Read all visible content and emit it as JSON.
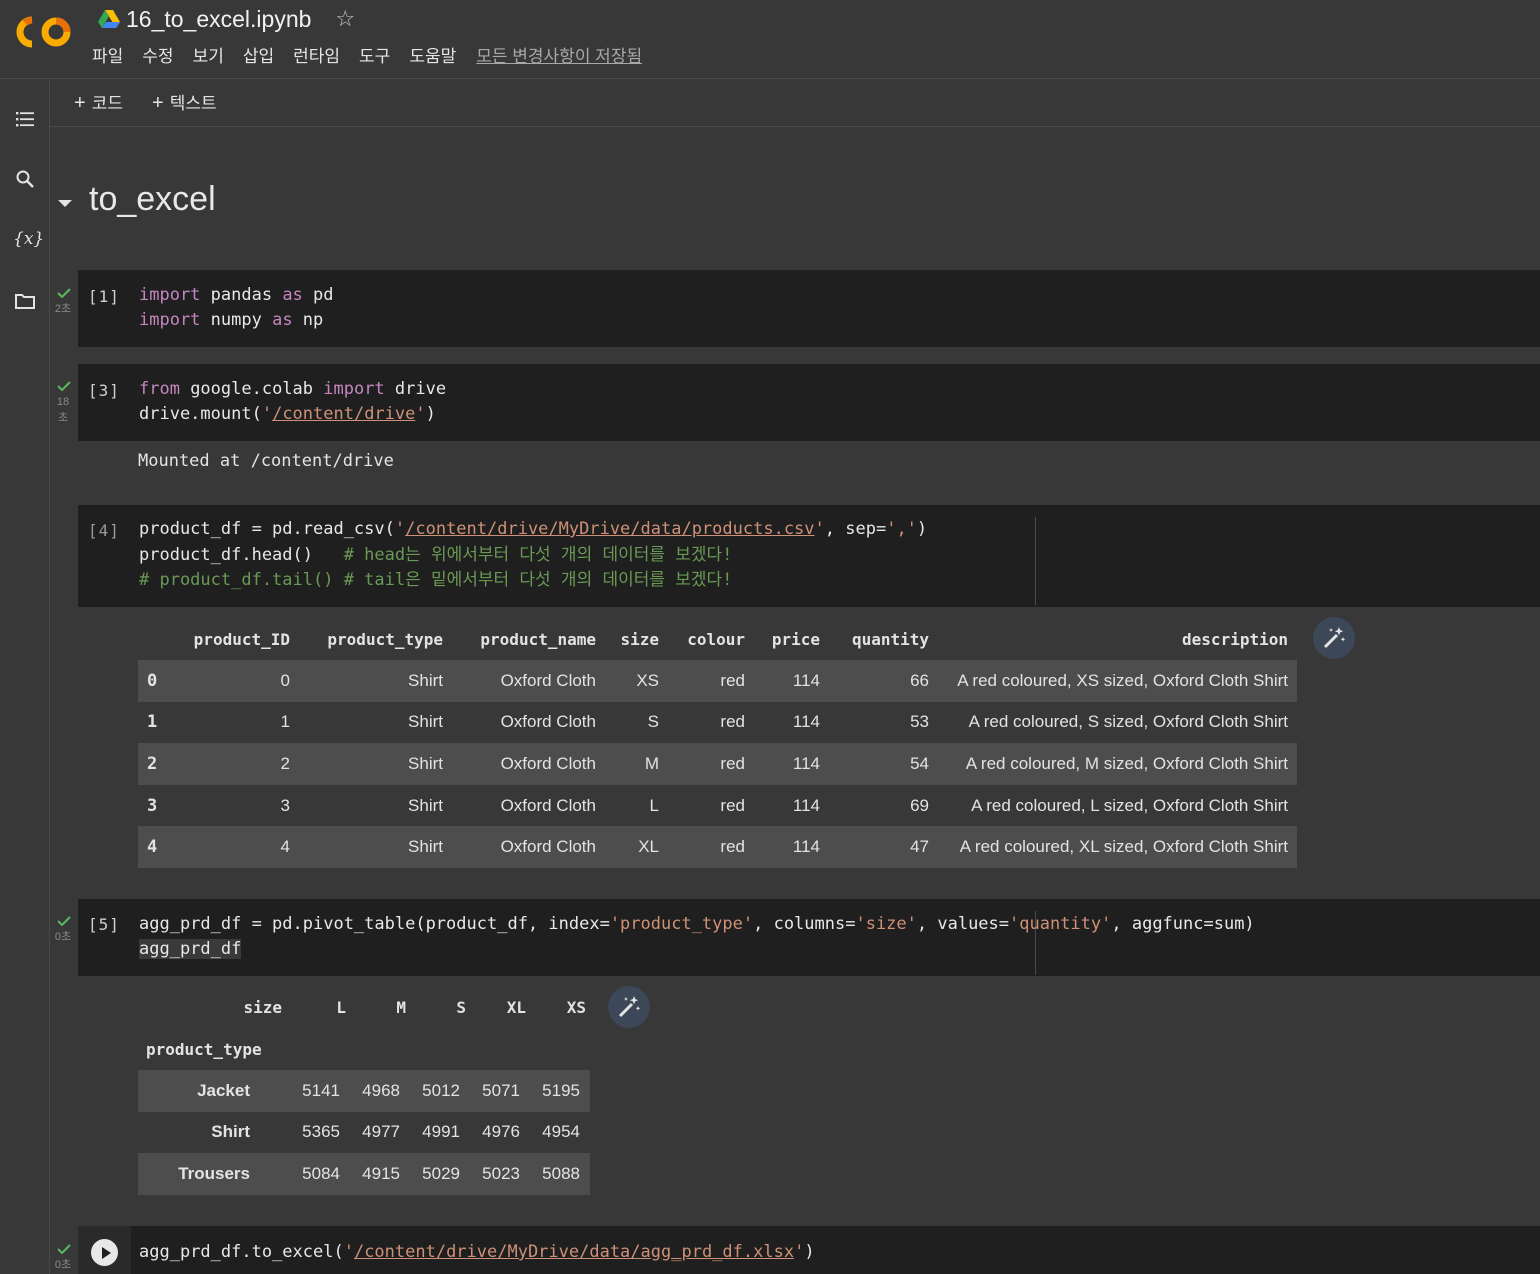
{
  "header": {
    "notebook_title": "16_to_excel.ipynb",
    "menu": [
      "파일",
      "수정",
      "보기",
      "삽입",
      "런타임",
      "도구",
      "도움말"
    ],
    "save_status": "모든 변경사항이 저장됨"
  },
  "toolbar": {
    "add_code": "코드",
    "add_text": "텍스트"
  },
  "section": {
    "title": "to_excel"
  },
  "cells": {
    "c1": {
      "exec": "[1]",
      "duration": "2초",
      "code_line1": {
        "kw1": "import",
        "t1": " pandas ",
        "kw2": "as",
        "t2": " pd"
      },
      "code_line2": {
        "kw1": "import",
        "t1": " numpy ",
        "kw2": "as",
        "t2": " np"
      }
    },
    "c3": {
      "exec": "[3]",
      "duration_1": "18",
      "duration_2": "초",
      "line1": {
        "kw1": "from",
        "t1": " google.colab ",
        "kw2": "import",
        "t2": " drive"
      },
      "line2": {
        "t1": "drive.mount(",
        "q1": "'",
        "path": "/content/drive",
        "q2": "'",
        "t2": ")"
      },
      "output": "Mounted at /content/drive"
    },
    "c4": {
      "exec": "[4]",
      "line1": {
        "t1": "product_df = pd.read_csv(",
        "q1": "'",
        "path": "/content/drive/MyDrive/data/products.csv",
        "q2": "'",
        "t2": ", sep=",
        "s": "','",
        "t3": ")"
      },
      "line2": {
        "t1": "product_df.head()   ",
        "cmt": "# head는 위에서부터 다섯 개의 데이터를 보겠다!"
      },
      "line3": {
        "cmt": "# product_df.tail() # tail은 밑에서부터 다섯 개의 데이터를 보겠다!"
      }
    },
    "c5": {
      "exec": "[5]",
      "duration": "0초",
      "line1": {
        "t1": "agg_prd_df = pd.pivot_table(product_df, index=",
        "s1": "'product_type'",
        "t2": ", columns=",
        "s2": "'size'",
        "t3": ", values=",
        "s3": "'quantity'",
        "t4": ", aggfunc=sum)"
      },
      "line2": "agg_prd_df"
    },
    "c6": {
      "duration": "0초",
      "line1": {
        "t1": "agg_prd_df.to_excel(",
        "q1": "'",
        "path": "/content/drive/MyDrive/data/agg_prd_df.xlsx",
        "q2": "'",
        "t2": ")"
      }
    }
  },
  "table1": {
    "columns": [
      "product_ID",
      "product_type",
      "product_name",
      "size",
      "colour",
      "price",
      "quantity",
      "description"
    ],
    "rows": [
      [
        "0",
        "0",
        "Shirt",
        "Oxford Cloth",
        "XS",
        "red",
        "114",
        "66",
        "A red coloured, XS sized, Oxford Cloth Shirt"
      ],
      [
        "1",
        "1",
        "Shirt",
        "Oxford Cloth",
        "S",
        "red",
        "114",
        "53",
        "A red coloured, S sized, Oxford Cloth Shirt"
      ],
      [
        "2",
        "2",
        "Shirt",
        "Oxford Cloth",
        "M",
        "red",
        "114",
        "54",
        "A red coloured, M sized, Oxford Cloth Shirt"
      ],
      [
        "3",
        "3",
        "Shirt",
        "Oxford Cloth",
        "L",
        "red",
        "114",
        "69",
        "A red coloured, L sized, Oxford Cloth Shirt"
      ],
      [
        "4",
        "4",
        "Shirt",
        "Oxford Cloth",
        "XL",
        "red",
        "114",
        "47",
        "A red coloured, XL sized, Oxford Cloth Shirt"
      ]
    ]
  },
  "table2": {
    "columns_name": "size",
    "columns": [
      "L",
      "M",
      "S",
      "XL",
      "XS"
    ],
    "index_name": "product_type",
    "rows": [
      [
        "Jacket",
        "5141",
        "4968",
        "5012",
        "5071",
        "5195"
      ],
      [
        "Shirt",
        "5365",
        "4977",
        "4991",
        "4976",
        "4954"
      ],
      [
        "Trousers",
        "5084",
        "4915",
        "5029",
        "5023",
        "5088"
      ]
    ]
  },
  "colors": {
    "keyword": "#c586c0",
    "string": "#ce9178",
    "comment": "#6a9955",
    "check": "#5cb85c"
  },
  "icons": [
    "colab-logo",
    "drive-icon",
    "star-icon",
    "toc-icon",
    "search-icon",
    "variables-icon",
    "folder-icon",
    "check-icon",
    "magic-wand-icon",
    "run-icon"
  ]
}
